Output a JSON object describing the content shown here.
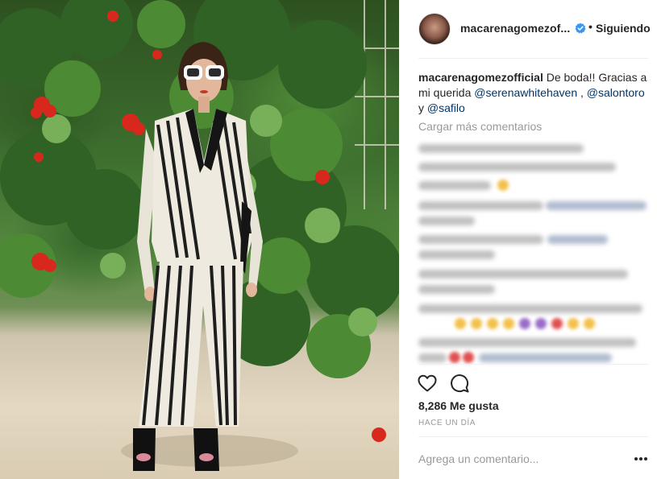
{
  "post": {
    "header": {
      "username": "macarenagomezofficial",
      "username_display": "macarenagomezof...",
      "separator": "•",
      "follow_state": "Siguiendo"
    },
    "caption": {
      "username": "macarenagomezofficial",
      "text_1": " De boda!! Gracias a mi querida ",
      "mention_1": "@serenawhitehaven",
      "text_2": " , ",
      "mention_2": "@salontoro",
      "text_3": " y ",
      "mention_3": "@safilo"
    },
    "comments": {
      "load_more_label": "Cargar más comentarios"
    },
    "likes": "8,286 Me gusta",
    "timestamp": "HACE UN DÍA",
    "comment_placeholder": "Agrega un comentario..."
  },
  "icons": {
    "verified": "verified-badge-icon",
    "like": "heart-icon",
    "comment": "comment-bubble-icon",
    "more": "more-options-icon"
  },
  "colors": {
    "verified_blue": "#3897f0",
    "mention_blue": "#003569",
    "text_primary": "#262626",
    "text_secondary": "#999999",
    "divider": "#efefef"
  }
}
